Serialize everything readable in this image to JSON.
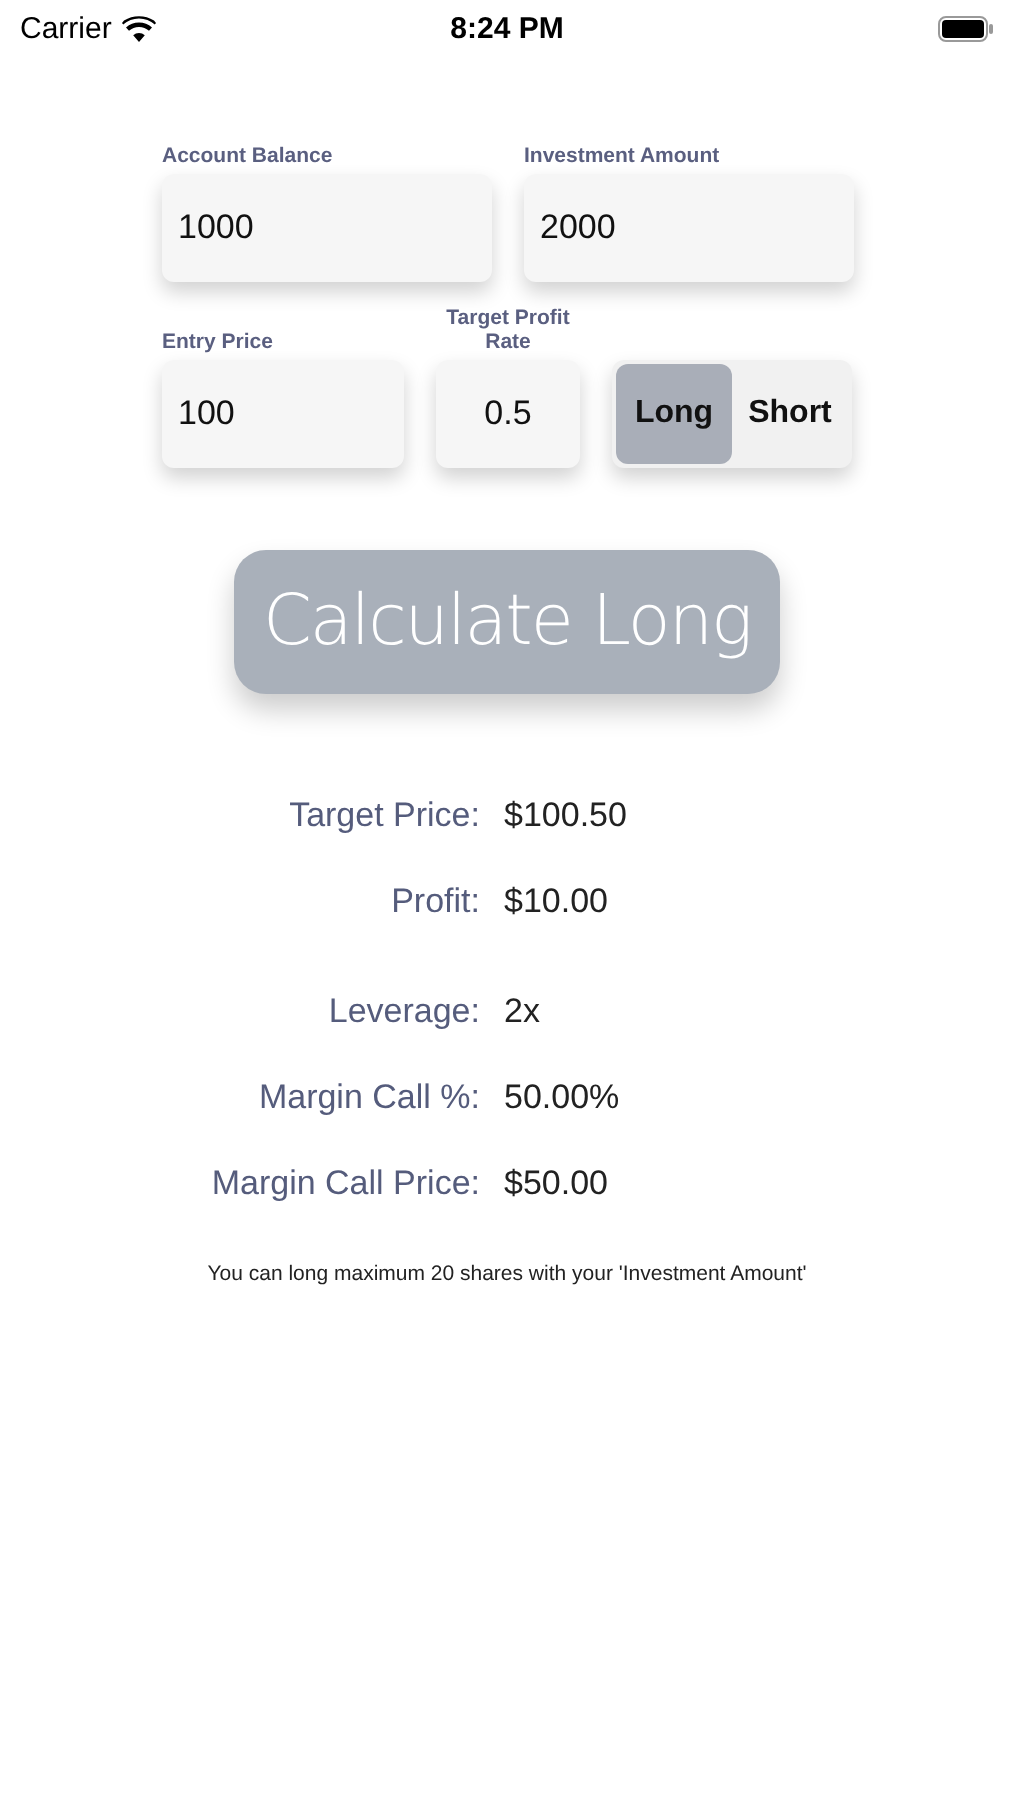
{
  "status_bar": {
    "carrier": "Carrier",
    "time": "8:24 PM"
  },
  "inputs": [
    {
      "label": "Account Balance",
      "value": "1000"
    },
    {
      "label": "Investment Amount",
      "value": "2000"
    },
    {
      "label": "Entry Price",
      "value": "100"
    },
    {
      "label": "Target Profit Rate",
      "value": "0.5"
    }
  ],
  "position": [
    {
      "label": "Long",
      "selected": true
    },
    {
      "label": "Short",
      "selected": false
    }
  ],
  "calculate_button": "Calculate Long",
  "results": [
    {
      "label": "Target Price:",
      "value": "$100.50"
    },
    {
      "label": "Profit:",
      "value": "$10.00"
    }
  ],
  "risk": [
    {
      "label": "Leverage:",
      "value": "2x"
    },
    {
      "label": "Margin Call %:",
      "value": "50.00%"
    },
    {
      "label": "Margin Call Price:",
      "value": "$50.00"
    }
  ],
  "note": "You can long maximum 20 shares with your 'Investment Amount'"
}
